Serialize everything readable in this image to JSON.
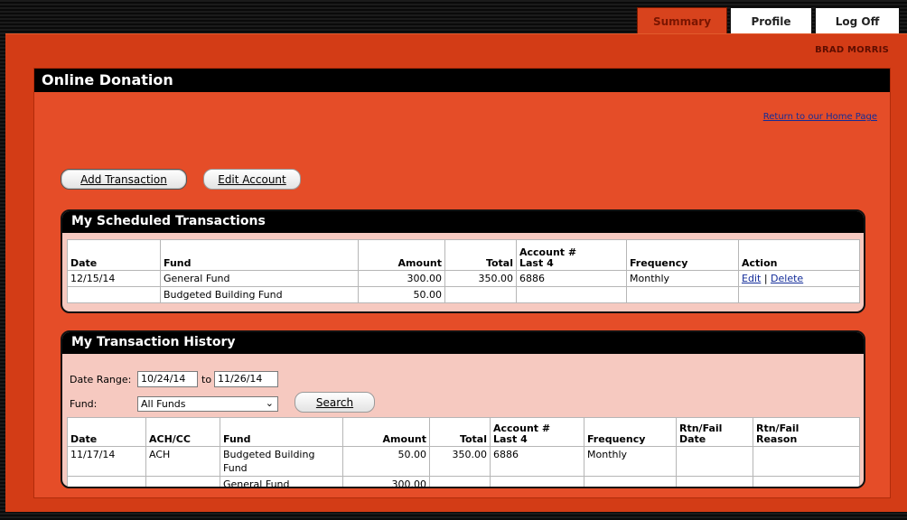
{
  "tabs": {
    "summary": "Summary",
    "profile": "Profile",
    "logoff": "Log Off"
  },
  "user": {
    "name": "BRAD MORRIS"
  },
  "page": {
    "title": "Online Donation",
    "home_link": "Return to our Home Page"
  },
  "buttons": {
    "add_transaction": "Add Transaction",
    "edit_account": "Edit Account",
    "search": "Search"
  },
  "scheduled": {
    "title": "My Scheduled Transactions",
    "headers": {
      "date": "Date",
      "fund": "Fund",
      "amount": "Amount",
      "total": "Total",
      "account_1": "Account #",
      "account_2": "Last 4",
      "frequency": "Frequency",
      "action": "Action"
    },
    "row": {
      "date": "12/15/14",
      "fund_1": "General Fund",
      "amount_1": "300.00",
      "fund_2": "Budgeted Building Fund",
      "amount_2": "50.00",
      "total": "350.00",
      "account": "6886",
      "frequency": "Monthly",
      "edit": "Edit",
      "separator": "|",
      "delete": "Delete"
    }
  },
  "history": {
    "title": "My Transaction History",
    "date_range_label": "Date Range:",
    "date_from": "10/24/14",
    "to_label": "to",
    "date_to": "11/26/14",
    "fund_label": "Fund:",
    "fund_selected": "All Funds",
    "headers": {
      "date": "Date",
      "ach_cc": "ACH/CC",
      "fund": "Fund",
      "amount": "Amount",
      "total": "Total",
      "account_1": "Account #",
      "account_2": "Last 4",
      "frequency": "Frequency",
      "rtn_date_1": "Rtn/Fail",
      "rtn_date_2": "Date",
      "rtn_reason_1": "Rtn/Fail",
      "rtn_reason_2": "Reason"
    },
    "row": {
      "date": "11/17/14",
      "ach_cc": "ACH",
      "fund_1": "Budgeted Building Fund",
      "amount_1": "50.00",
      "fund_2": "General Fund",
      "amount_2": "300.00",
      "total": "350.00",
      "account": "6886",
      "frequency": "Monthly"
    }
  }
}
